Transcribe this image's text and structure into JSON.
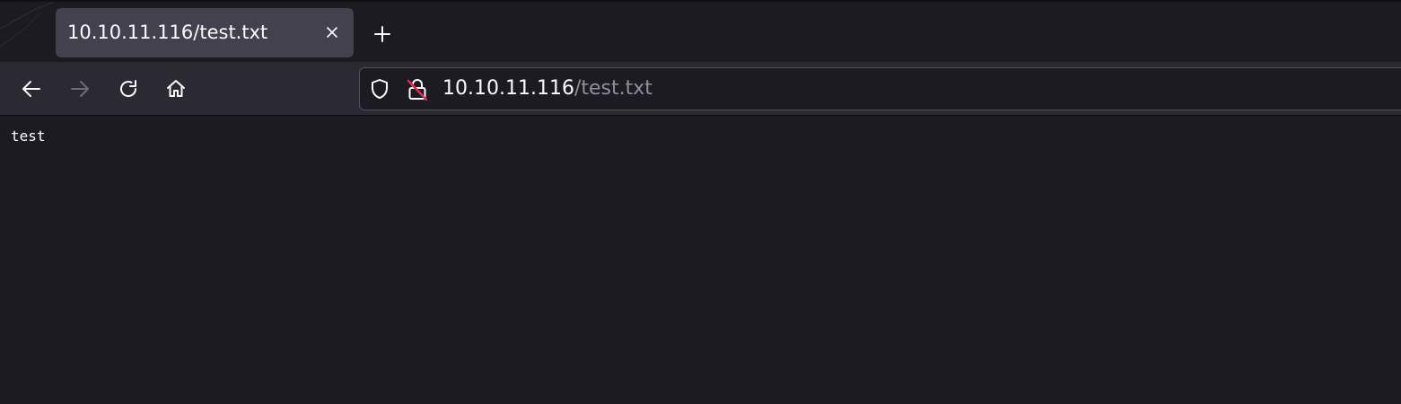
{
  "tab": {
    "title": "10.10.11.116/test.txt"
  },
  "urlbar": {
    "host": "10.10.11.116",
    "path": "/test.txt"
  },
  "content": {
    "text": "test"
  },
  "icons": {
    "close": "close-icon",
    "new_tab": "plus-icon",
    "back": "arrow-left-icon",
    "forward": "arrow-right-icon",
    "reload": "reload-icon",
    "home": "home-icon",
    "tracking_protection": "shield-icon",
    "insecure": "insecure-lock-icon"
  },
  "colors": {
    "background": "#1c1b22",
    "toolbar": "#2b2a33",
    "tab_selected": "#42414d",
    "text": "#fbfbfe",
    "url_path": "#8f8f9d",
    "insecure_slash": "#e22850"
  }
}
